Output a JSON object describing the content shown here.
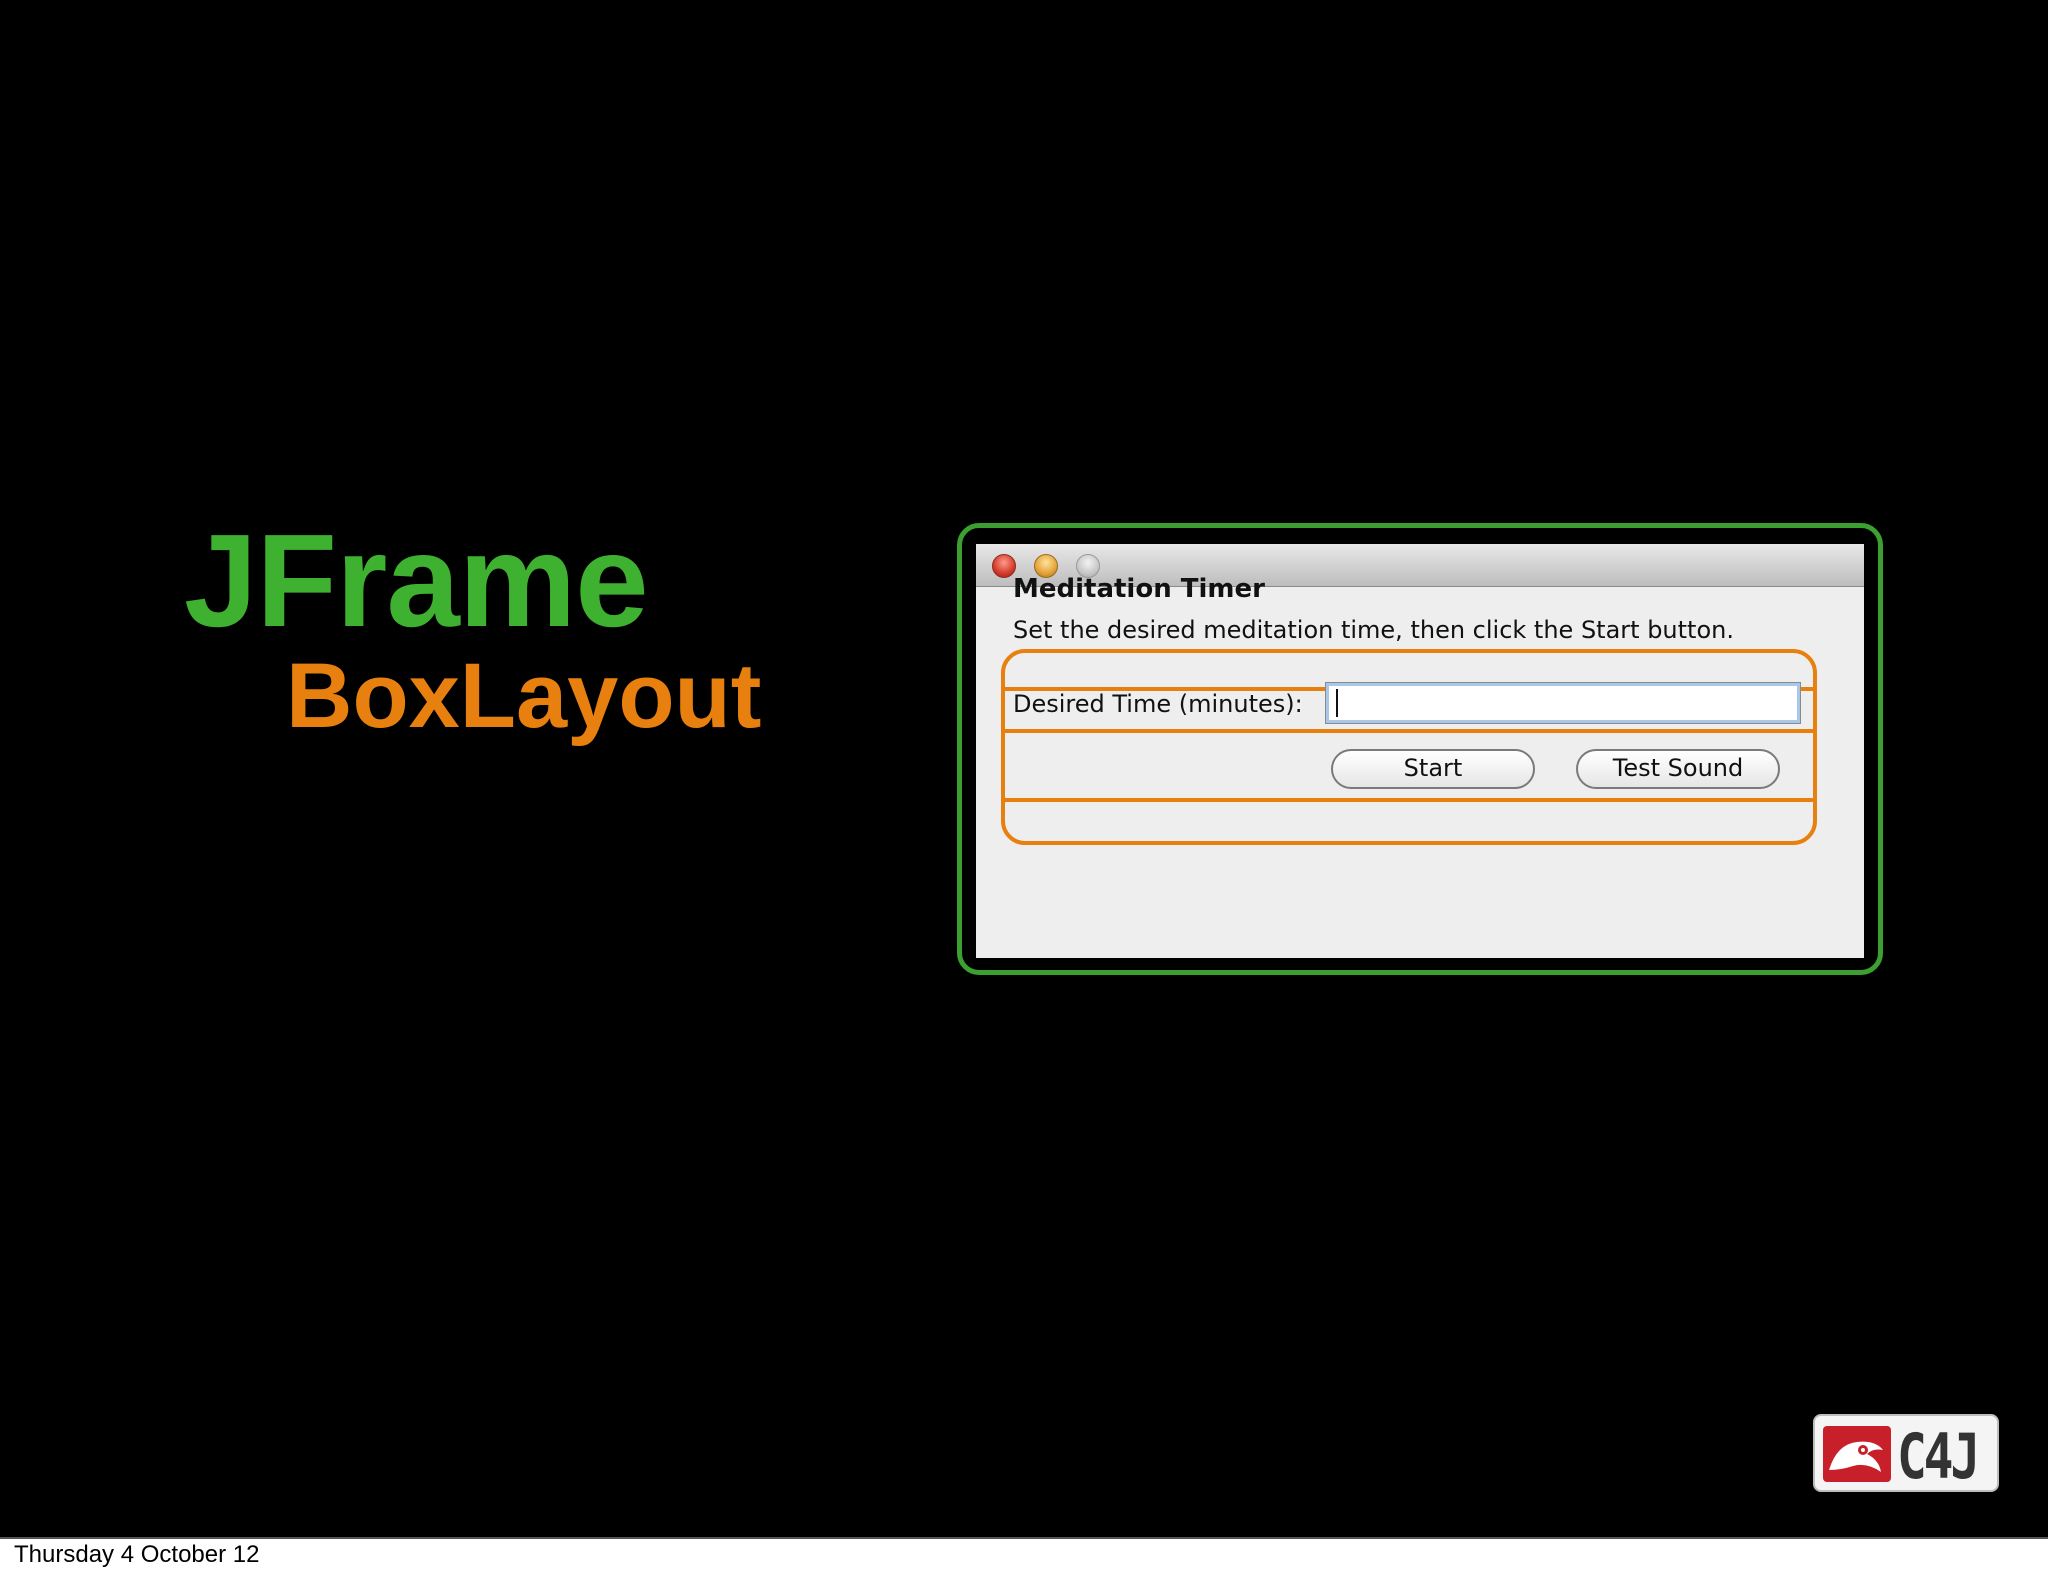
{
  "slide": {
    "title_primary": "JFrame",
    "title_secondary": "BoxLayout",
    "colors": {
      "primary_title": "#3fb130",
      "secondary_title": "#e8800f",
      "frame_outline": "#3ca030",
      "box_outline": "#e8800f",
      "background": "#000000"
    }
  },
  "window": {
    "traffic_lights": [
      "close",
      "minimize",
      "zoom"
    ],
    "heading": "Meditation Timer",
    "description": "Set the desired meditation time, then click the Start button.",
    "field_label": "Desired Time (minutes):",
    "time_input": {
      "value": "",
      "placeholder": ""
    },
    "buttons": {
      "start": "Start",
      "test_sound": "Test Sound"
    }
  },
  "logo": {
    "text": "C4J",
    "icon": "c4j-logo-icon"
  },
  "footer": {
    "date": "Thursday 4 October 12"
  }
}
